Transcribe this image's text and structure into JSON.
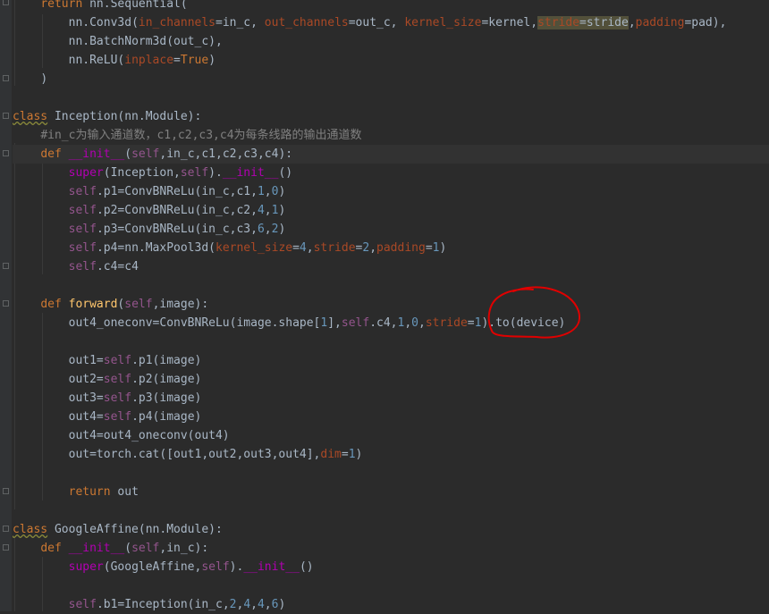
{
  "code": {
    "l0": {
      "t1": "return",
      "t2": " nn.Sequential("
    },
    "l1": {
      "t1": "nn.Conv3d(",
      "t2": "in_channels",
      "t3": "=in_c, ",
      "t4": "out_channels",
      "t5": "=out_c, ",
      "t6": "kernel_size",
      "t7": "=kernel,",
      "t8": "stride",
      "t9": "=stride",
      "t10": ",",
      "t11": "padding",
      "t12": "=pad),"
    },
    "l2": {
      "t1": "nn.BatchNorm3d(out_c),"
    },
    "l3": {
      "t1": "nn.ReLU(",
      "t2": "inplace",
      "t3": "=",
      "t4": "True",
      "t5": ")"
    },
    "l4": {
      "t1": ")"
    },
    "l6": {
      "t1": "class",
      "t2": " Inception(nn.Module):"
    },
    "l7": {
      "t1": "#in_c为输入通道数，c1,c2,c3,c4为每条线路的输出通道数"
    },
    "l8": {
      "t1": "def",
      "t2": " ",
      "t3": "__init__",
      "t4": "(",
      "t5": "self",
      "t6": ",in_c,c1,c2,c3,c4):"
    },
    "l9": {
      "t1": "super",
      "t2": "(Inception,",
      "t3": "self",
      "t4": ").",
      "t5": "__init__",
      "t6": "()"
    },
    "l10": {
      "t1": "self",
      "t2": ".p1=ConvBNReLu(in_c,c1,",
      "t3": "1",
      "t4": ",",
      "t5": "0",
      "t6": ")"
    },
    "l11": {
      "t1": "self",
      "t2": ".p2=ConvBNReLu(in_c,c2,",
      "t3": "4",
      "t4": ",",
      "t5": "1",
      "t6": ")"
    },
    "l12": {
      "t1": "self",
      "t2": ".p3=ConvBNReLu(in_c,c3,",
      "t3": "6",
      "t4": ",",
      "t5": "2",
      "t6": ")"
    },
    "l13": {
      "t1": "self",
      "t2": ".p4=nn.MaxPool3d(",
      "t3": "kernel_size",
      "t4": "=",
      "t5": "4",
      "t6": ",",
      "t7": "stride",
      "t8": "=",
      "t9": "2",
      "t10": ",",
      "t11": "padding",
      "t12": "=",
      "t13": "1",
      "t14": ")"
    },
    "l14": {
      "t1": "self",
      "t2": ".c4=c4"
    },
    "l16": {
      "t1": "def",
      "t2": " ",
      "t3": "forward",
      "t4": "(",
      "t5": "self",
      "t6": ",image):"
    },
    "l17": {
      "t1": "out4_oneconv=ConvBNReLu(image.shape[",
      "t2": "1",
      "t3": "],",
      "t4": "self",
      "t5": ".c4,",
      "t6": "1",
      "t7": ",",
      "t8": "0",
      "t9": ",",
      "t10": "stride",
      "t11": "=",
      "t12": "1",
      "t13": ").to(device)"
    },
    "l19": {
      "t1": "out1=",
      "t2": "self",
      "t3": ".p1(image)"
    },
    "l20": {
      "t1": "out2=",
      "t2": "self",
      "t3": ".p2(image)"
    },
    "l21": {
      "t1": "out3=",
      "t2": "self",
      "t3": ".p3(image)"
    },
    "l22": {
      "t1": "out4=",
      "t2": "self",
      "t3": ".p4(image)"
    },
    "l23": {
      "t1": "out4=out4_oneconv(out4)"
    },
    "l24": {
      "t1": "out=torch.cat([out1,out2,out3,out4],",
      "t2": "dim",
      "t3": "=",
      "t4": "1",
      "t5": ")"
    },
    "l26": {
      "t1": "return",
      "t2": " out"
    },
    "l28": {
      "t1": "class",
      "t2": " GoogleAffine(nn.Module):"
    },
    "l29": {
      "t1": "def",
      "t2": " ",
      "t3": "__init__",
      "t4": "(",
      "t5": "self",
      "t6": ",in_c):"
    },
    "l30": {
      "t1": "super",
      "t2": "(GoogleAffine,",
      "t3": "self",
      "t4": ").",
      "t5": "__init__",
      "t6": "()"
    },
    "l32": {
      "t1": "self",
      "t2": ".b1=Inception(in_c,",
      "t3": "2",
      "t4": ",",
      "t5": "4",
      "t6": ",",
      "t7": "4",
      "t8": ",",
      "t9": "6",
      "t10": ")"
    }
  },
  "colors": {
    "background": "#2b2b2b",
    "gutter": "#313335",
    "keyword": "#cc7832",
    "function": "#ffc66d",
    "number": "#6897bb",
    "self": "#94558d",
    "dunder": "#b200b2",
    "kwarg": "#aa4926",
    "comment": "#808080",
    "text": "#a9b7c6",
    "annotation": "#e00000"
  },
  "annotation": {
    "shape": "hand-drawn red circle around stride=1)",
    "color": "#e00000"
  }
}
